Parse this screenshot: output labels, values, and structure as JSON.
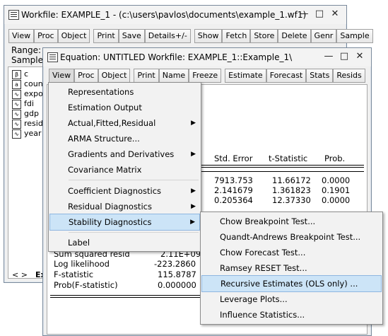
{
  "workfile": {
    "title": "Workfile: EXAMPLE_1 - (c:\\users\\pavlos\\documents\\example_1.wf1)",
    "toolbar": [
      "View",
      "Proc",
      "Object",
      "Print",
      "Save",
      "Details+/-",
      "Show",
      "Fetch",
      "Store",
      "Delete",
      "Genr",
      "Sample"
    ],
    "range_label": "Range:",
    "sample_label": "Sample",
    "objects": [
      "c",
      "coun",
      "expo",
      "fdi",
      "gdp",
      "resid",
      "year"
    ],
    "tab_label": "Exa"
  },
  "equation": {
    "title": "Equation: UNTITLED   Workfile: EXAMPLE_1::Example_1\\",
    "toolbar": [
      "View",
      "Proc",
      "Object",
      "Print",
      "Name",
      "Freeze",
      "Estimate",
      "Forecast",
      "Stats",
      "Resids"
    ],
    "headers": [
      "Std. Error",
      "t-Statistic",
      "Prob."
    ],
    "rows": [
      [
        "7913.753",
        "11.66172",
        "0.0000"
      ],
      [
        "2.141679",
        "1.361823",
        "0.1901"
      ],
      [
        "0.205364",
        "12.37330",
        "0.0000"
      ]
    ],
    "stats": [
      [
        "Sum squared resid",
        "2.11E+09"
      ],
      [
        "Log likelihood",
        "-223.2860"
      ],
      [
        "F-statistic",
        "115.8787"
      ],
      [
        "Prob(F-statistic)",
        "0.000000"
      ]
    ]
  },
  "view_menu": {
    "items": [
      "Representations",
      "Estimation Output",
      "Actual,Fitted,Residual",
      "ARMA Structure...",
      "Gradients and Derivatives",
      "Covariance Matrix",
      "Coefficient Diagnostics",
      "Residual Diagnostics",
      "Stability Diagnostics",
      "Label"
    ],
    "submenu_flags": [
      false,
      false,
      true,
      false,
      true,
      false,
      true,
      true,
      true,
      false
    ]
  },
  "stability_submenu": {
    "items": [
      "Chow Breakpoint Test...",
      "Quandt-Andrews Breakpoint Test...",
      "Chow Forecast Test...",
      "Ramsey RESET Test...",
      "Recursive Estimates (OLS only) ...",
      "Leverage Plots...",
      "Influence Statistics..."
    ],
    "highlighted": "Recursive Estimates (OLS only) ..."
  },
  "icons": {
    "minimize": "minimize-icon",
    "maximize": "maximize-icon",
    "close": "close-icon",
    "arrow": "chevron-right-icon"
  },
  "colors": {
    "highlight": "#cce4f7",
    "highlight_border": "#8fb6e0"
  }
}
